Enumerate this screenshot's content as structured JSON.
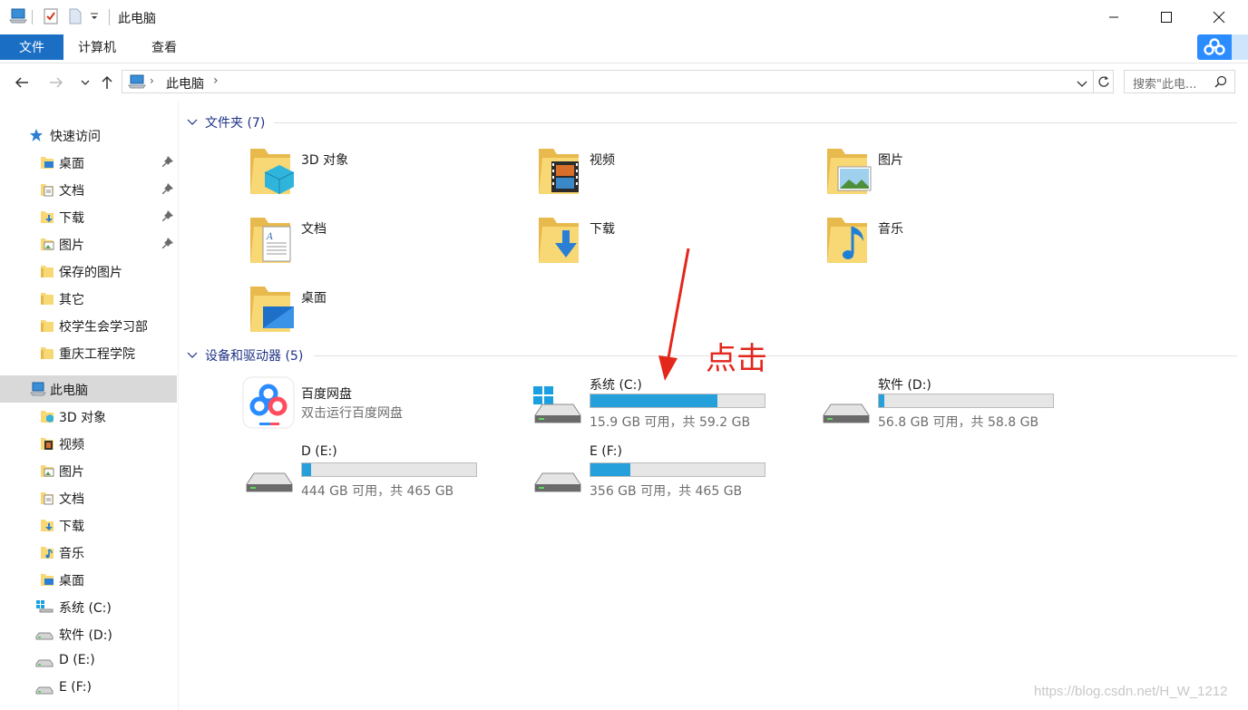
{
  "window": {
    "title": "此电脑"
  },
  "ribbon": {
    "tabs": [
      "文件",
      "计算机",
      "查看"
    ]
  },
  "address": {
    "path": "此电脑",
    "search_placeholder": "搜索\"此电..."
  },
  "sidebar": {
    "quick_access": "快速访问",
    "quick_items": [
      {
        "label": "桌面",
        "icon": "desktop-folder-icon",
        "pinned": true
      },
      {
        "label": "文档",
        "icon": "documents-folder-icon",
        "pinned": true
      },
      {
        "label": "下载",
        "icon": "downloads-folder-icon",
        "pinned": true
      },
      {
        "label": "图片",
        "icon": "pictures-folder-icon",
        "pinned": true
      },
      {
        "label": "保存的图片",
        "icon": "folder-icon",
        "pinned": false
      },
      {
        "label": "其它",
        "icon": "folder-icon",
        "pinned": false
      },
      {
        "label": "校学生会学习部",
        "icon": "folder-icon",
        "pinned": false
      },
      {
        "label": "重庆工程学院",
        "icon": "folder-icon",
        "pinned": false
      }
    ],
    "this_pc": "此电脑",
    "pc_items": [
      {
        "label": "3D 对象",
        "icon": "3d-objects-icon"
      },
      {
        "label": "视频",
        "icon": "videos-icon"
      },
      {
        "label": "图片",
        "icon": "pictures-icon"
      },
      {
        "label": "文档",
        "icon": "documents-icon"
      },
      {
        "label": "下载",
        "icon": "downloads-icon"
      },
      {
        "label": "音乐",
        "icon": "music-icon"
      },
      {
        "label": "桌面",
        "icon": "desktop-icon"
      },
      {
        "label": "系统 (C:)",
        "icon": "windows-drive-icon"
      },
      {
        "label": "软件 (D:)",
        "icon": "drive-icon"
      },
      {
        "label": "D (E:)",
        "icon": "drive-icon"
      },
      {
        "label": "E (F:)",
        "icon": "drive-icon"
      }
    ]
  },
  "folders_section": {
    "title": "文件夹 (7)",
    "items": [
      {
        "name": "3D 对象",
        "icon": "3d-objects-icon"
      },
      {
        "name": "视频",
        "icon": "videos-icon"
      },
      {
        "name": "图片",
        "icon": "pictures-icon"
      },
      {
        "name": "文档",
        "icon": "documents-icon"
      },
      {
        "name": "下载",
        "icon": "downloads-icon"
      },
      {
        "name": "音乐",
        "icon": "music-icon"
      },
      {
        "name": "桌面",
        "icon": "desktop-icon"
      }
    ]
  },
  "devices_section": {
    "title": "设备和驱动器 (5)",
    "baidu": {
      "name": "百度网盘",
      "subtitle": "双击运行百度网盘"
    },
    "drives": [
      {
        "name": "系统 (C:)",
        "info": "15.9 GB 可用，共 59.2 GB",
        "used_fraction": 0.73,
        "system": true
      },
      {
        "name": "软件 (D:)",
        "info": "56.8 GB 可用，共 58.8 GB",
        "used_fraction": 0.03,
        "system": false
      },
      {
        "name": "D (E:)",
        "info": "444 GB 可用，共 465 GB",
        "used_fraction": 0.05,
        "system": false
      },
      {
        "name": "E (F:)",
        "info": "356 GB 可用，共 465 GB",
        "used_fraction": 0.23,
        "system": false
      }
    ]
  },
  "annotation": "点击",
  "watermark": "https://blog.csdn.net/H_W_1212",
  "colors": {
    "accent": "#1a6fc4",
    "drive_bar": "#26a0da",
    "annotation": "#e3271b",
    "folder": "#f8d775"
  }
}
